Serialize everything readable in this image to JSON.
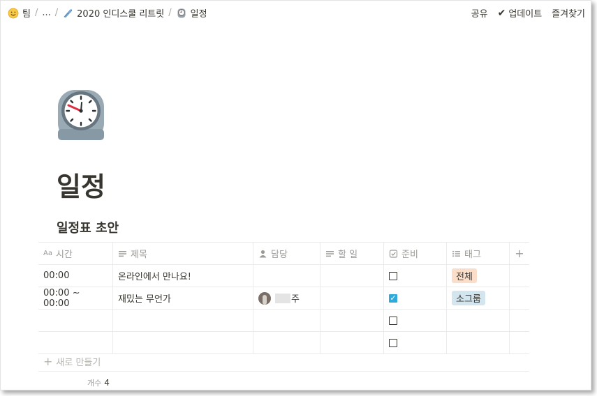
{
  "breadcrumbs": [
    {
      "label": "팀",
      "icon": "smiley-emoji-icon"
    },
    {
      "label": "..."
    },
    {
      "label": "2020 인디스쿨 리트릿",
      "icon": "feather-pen-icon"
    },
    {
      "label": "일정",
      "icon": "clock-emoji-icon"
    }
  ],
  "actions": {
    "share": "공유",
    "updates": "업데이트",
    "favorite": "즐겨찾기"
  },
  "page": {
    "icon": "mantelpiece-clock-icon",
    "title": "일정"
  },
  "database": {
    "title": "일정표 초안",
    "columns": [
      "시간",
      "제목",
      "담당",
      "할 일",
      "준비",
      "태그"
    ],
    "rows": [
      {
        "time": "00:00",
        "title": "온라인에서 만나요!",
        "owner": "",
        "todo": "",
        "ready": false,
        "tag": "전체"
      },
      {
        "time": "00:00 ~ 00:00",
        "title": "재밌는 무언가",
        "owner": "주",
        "todo": "",
        "ready": true,
        "tag": "소그룹"
      },
      {
        "time": "",
        "title": "",
        "owner": "",
        "todo": "",
        "ready": false,
        "tag": ""
      },
      {
        "time": "",
        "title": "",
        "owner": "",
        "todo": "",
        "ready": false,
        "tag": ""
      }
    ],
    "new_row": "새로 만들기",
    "count_label": "개수",
    "count_value": "4"
  },
  "colors": {
    "tag_all": "#fadec9",
    "tag_group": "#d3e5ef",
    "checkbox_on": "#2eaadc"
  }
}
